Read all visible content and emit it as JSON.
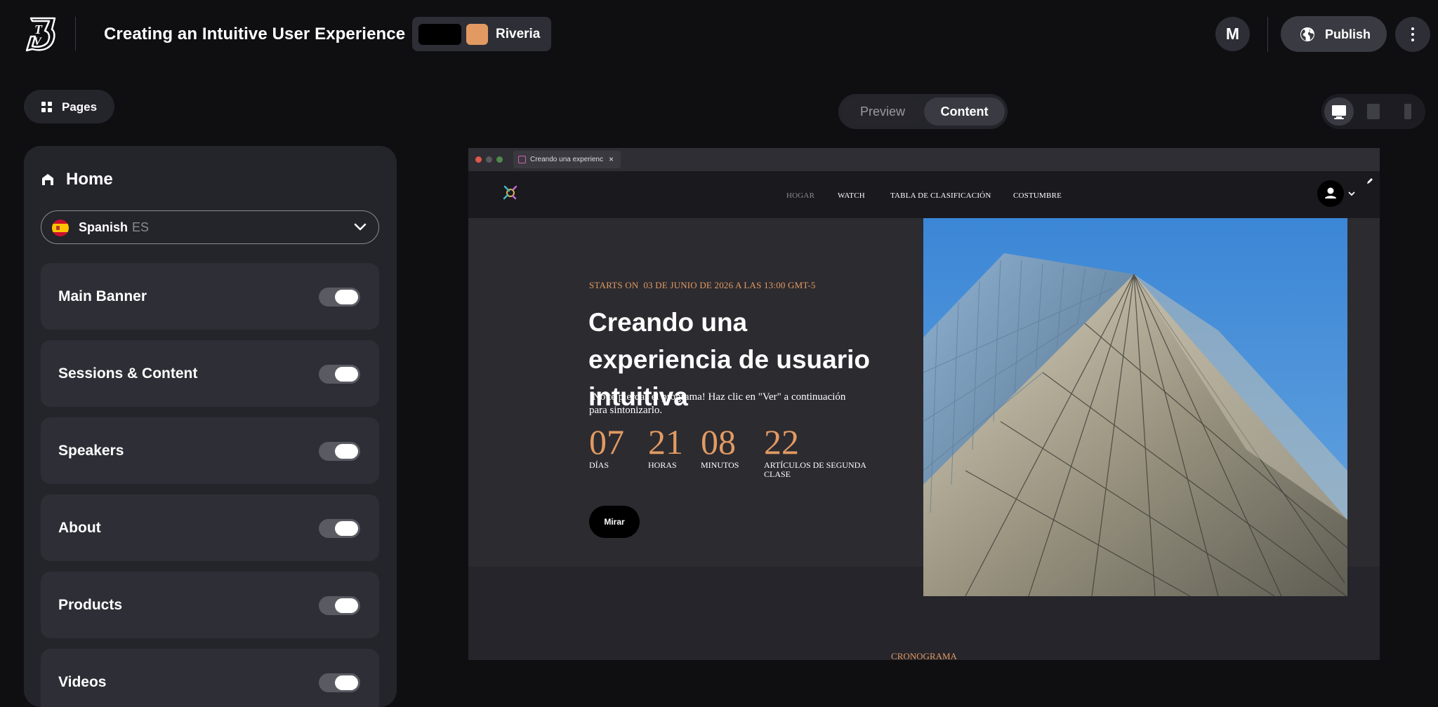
{
  "header": {
    "title": "Creating an Intuitive User Experience",
    "theme_name": "Riveria",
    "theme_colors": [
      "#000000",
      "#e29a62"
    ],
    "avatar_initial": "M",
    "publish_label": "Publish"
  },
  "toolbar": {
    "pages_label": "Pages",
    "view_modes": [
      "Preview",
      "Content"
    ],
    "active_view": "Content",
    "devices": [
      "desktop-icon",
      "tablet-icon",
      "mobile-icon"
    ],
    "active_device": "desktop-icon"
  },
  "sidebar": {
    "page_title": "Home",
    "language": {
      "name": "Spanish",
      "code": "ES"
    },
    "sections": [
      {
        "label": "Main Banner",
        "enabled": true
      },
      {
        "label": "Sessions & Content",
        "enabled": true
      },
      {
        "label": "Speakers",
        "enabled": true
      },
      {
        "label": "About",
        "enabled": true
      },
      {
        "label": "Products",
        "enabled": true
      },
      {
        "label": "Videos",
        "enabled": true
      }
    ]
  },
  "preview": {
    "browser_tab": "Creando una experienci...",
    "nav": [
      "HOGAR",
      "WATCH",
      "TABLA DE CLASIFICACIÓN",
      "COSTUMBRE"
    ],
    "starts_label": "STARTS ON",
    "starts_date": "03 DE JUNIO DE 2026 A LAS 13:00 GMT-5",
    "title": "Creando una experiencia de usuario intuitiva",
    "subtitle": "¡No te pierdas el programa! Haz clic en \"Ver\" a continuación para sintonizarlo.",
    "countdown": [
      {
        "value": "07",
        "unit": "DÍAS"
      },
      {
        "value": "21",
        "unit": "HORAS"
      },
      {
        "value": "08",
        "unit": "MINUTOS"
      },
      {
        "value": "22",
        "unit": "ARTÍCULOS DE SEGUNDA CLASE"
      }
    ],
    "watch_label": "Mirar",
    "schedule_heading": "CRONOGRAMA"
  }
}
